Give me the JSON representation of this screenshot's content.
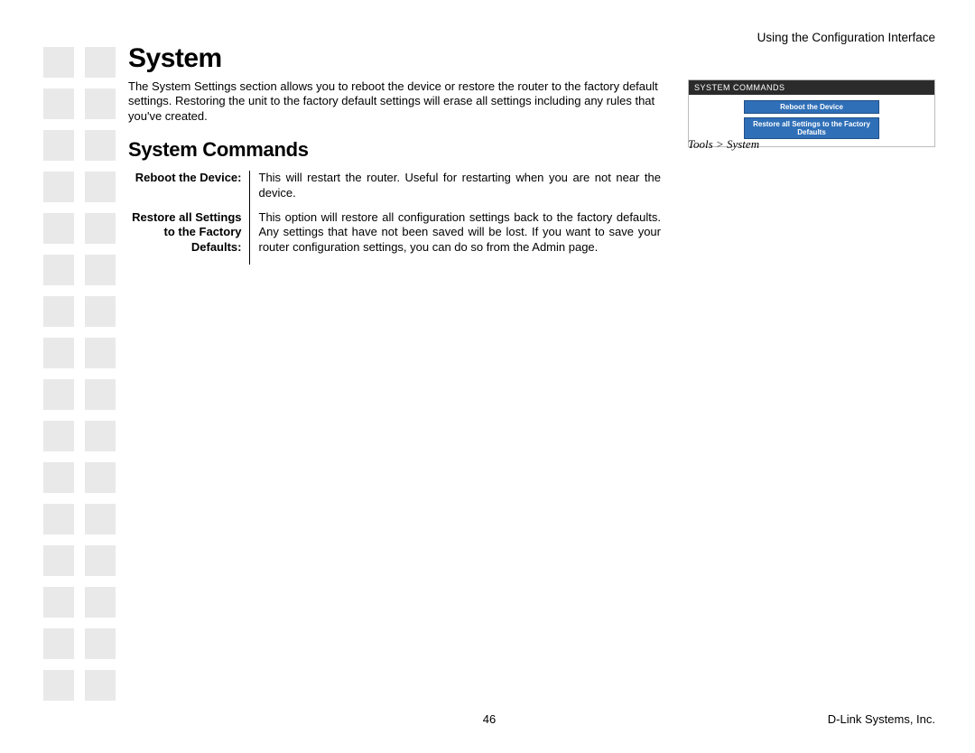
{
  "header": {
    "section_label": "Using the Configuration Interface"
  },
  "main": {
    "h1": "System",
    "intro": "The System Settings section allows you to reboot the device or restore the router to the factory default settings. Restoring the unit to the factory default settings will erase all settings including any rules that you've created.",
    "h2": "System Commands",
    "defs": [
      {
        "label": "Reboot the Device:",
        "desc": "This will restart the router. Useful for restarting when you are not near the device."
      },
      {
        "label": "Restore all Settings to the Factory Defaults:",
        "desc": "This option will restore all configuration settings back to the factory defaults. Any settings that have not been saved will be lost. If you want to save your router configuration settings, you can do so from the Admin page."
      }
    ]
  },
  "thumb": {
    "header": "SYSTEM COMMANDS",
    "btn1": "Reboot the Device",
    "btn2": "Restore all Settings to the Factory Defaults",
    "caption": "Tools > System"
  },
  "footer": {
    "page": "46",
    "company": "D-Link Systems, Inc."
  }
}
